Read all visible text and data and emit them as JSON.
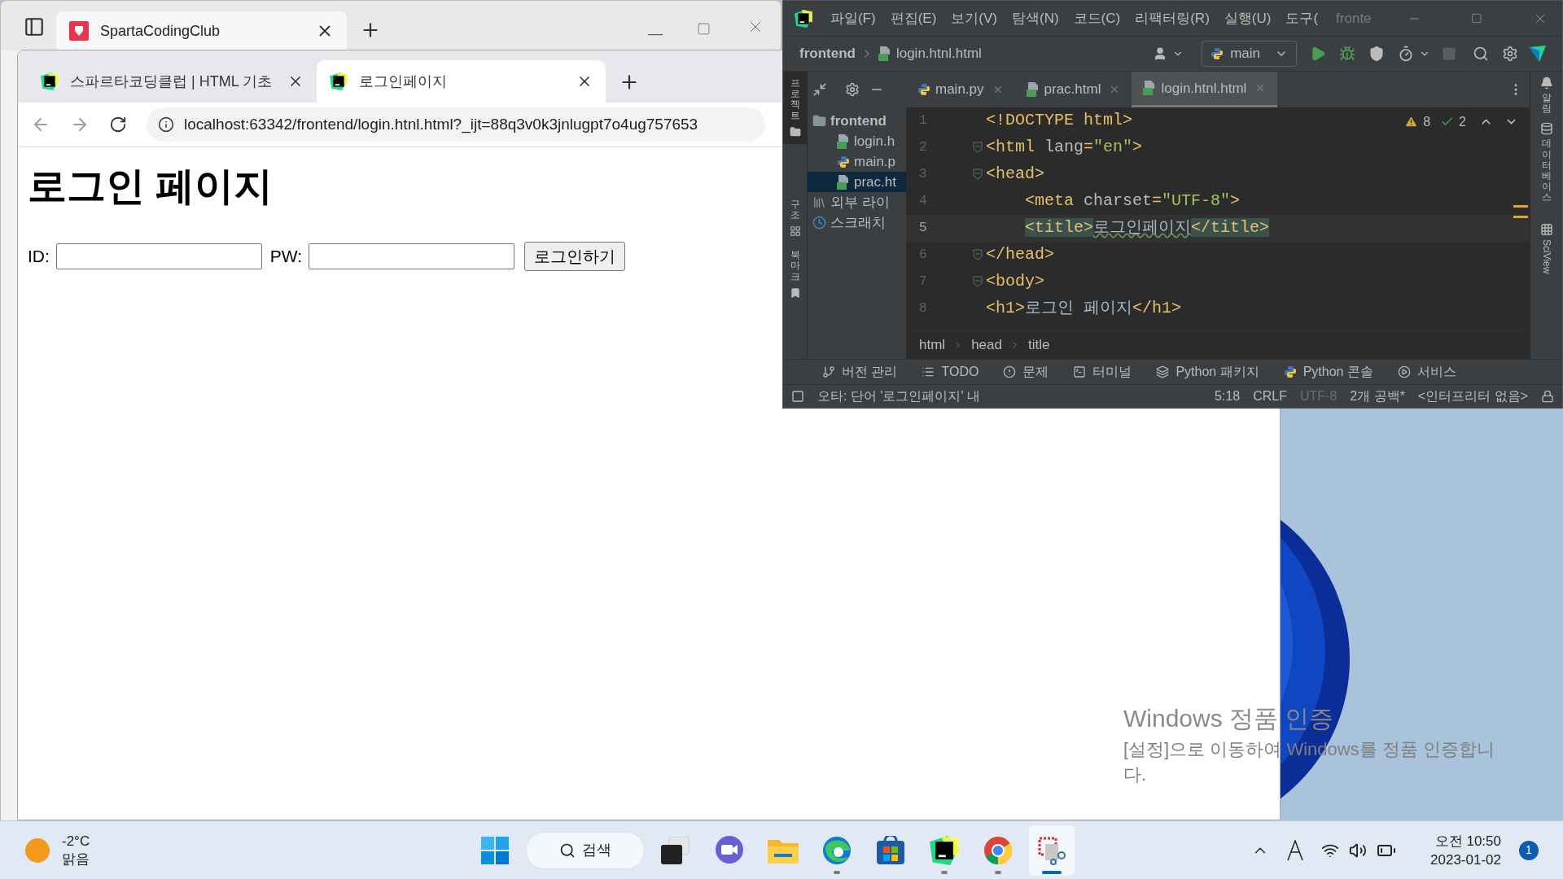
{
  "back_browser": {
    "tab_title": "SpartaCodingClub"
  },
  "browser": {
    "tabs": [
      {
        "title": "스파르타코딩클럽 | HTML 기초",
        "selected": false
      },
      {
        "title": "로그인페이지",
        "selected": true
      }
    ],
    "address": "localhost:63342/frontend/login.htnl.html?_ijt=88q3v0k3jnlugpt7o4ug757653",
    "page": {
      "heading": "로그인 페이지",
      "fields": [
        {
          "label": "ID:"
        },
        {
          "label": "PW:"
        }
      ],
      "button": "로그인하기"
    }
  },
  "ide": {
    "menu": [
      "파일(F)",
      "편집(E)",
      "보기(V)",
      "탐색(N)",
      "코드(C)",
      "리팩터링(R)",
      "실행(U)",
      "도구("
    ],
    "title": "fronte",
    "nav_project": "frontend",
    "nav_file": "login.htnl.html",
    "run_config": "main",
    "left_tools": [
      {
        "label": "프로젝트",
        "kind": "folder",
        "selected": true
      },
      {
        "label": "구조",
        "kind": "structure",
        "selected": false
      },
      {
        "label": "북마크",
        "kind": "bookmark",
        "selected": false
      }
    ],
    "right_tools": [
      {
        "label": "알림",
        "kind": "bell"
      },
      {
        "label": "데이터베이스",
        "kind": "database"
      },
      {
        "label": "SciView",
        "kind": "grid"
      }
    ],
    "tree": [
      {
        "label": "frontend",
        "kind": "folder",
        "selected": false,
        "children": [
          {
            "label": "login.h",
            "kind": "html",
            "selected": false
          },
          {
            "label": "main.p",
            "kind": "python",
            "selected": false
          },
          {
            "label": "prac.ht",
            "kind": "html",
            "selected": true
          }
        ]
      },
      {
        "label": "외부 라이",
        "kind": "library",
        "selected": false
      },
      {
        "label": "스크래치",
        "kind": "scratch",
        "selected": false
      }
    ],
    "editor_tabs": [
      {
        "label": "main.py",
        "kind": "python",
        "selected": false
      },
      {
        "label": "prac.html",
        "kind": "html",
        "selected": false
      },
      {
        "label": "login.htnl.html",
        "kind": "html",
        "selected": true
      }
    ],
    "inspections": {
      "warnings": "8",
      "ok": "2"
    },
    "code": [
      {
        "number": "1",
        "current": false,
        "fold": false,
        "segments": [
          {
            "t": "<!DOCTYPE html>",
            "kind": "tag"
          }
        ]
      },
      {
        "number": "2",
        "current": false,
        "fold": true,
        "segments": [
          {
            "t": "<html ",
            "kind": "tag"
          },
          {
            "t": "lang",
            "kind": "attr"
          },
          {
            "t": "=",
            "kind": "tag"
          },
          {
            "t": "\"en\"",
            "kind": "string"
          },
          {
            "t": ">",
            "kind": "tag"
          }
        ]
      },
      {
        "number": "3",
        "current": false,
        "fold": true,
        "segments": [
          {
            "t": "<head>",
            "kind": "tag"
          }
        ],
        "children": [
          {
            "number": "4",
            "current": false,
            "fold": false,
            "segments": [
              {
                "t": "<meta ",
                "kind": "tag"
              },
              {
                "t": "charset",
                "kind": "attr"
              },
              {
                "t": "=",
                "kind": "tag"
              },
              {
                "t": "\"UTF-8\"",
                "kind": "string"
              },
              {
                "t": ">",
                "kind": "tag"
              }
            ]
          },
          {
            "number": "5",
            "current": true,
            "fold": false,
            "segments": [
              {
                "t": "<title>",
                "kind": "tag_match"
              },
              {
                "t": "로그인페이지",
                "kind": "typo"
              },
              {
                "t": "</title>",
                "kind": "tag_match"
              }
            ]
          }
        ]
      },
      {
        "number": "6",
        "current": false,
        "fold": true,
        "segments": [
          {
            "t": "</head>",
            "kind": "tag"
          }
        ]
      },
      {
        "number": "7",
        "current": false,
        "fold": true,
        "segments": [
          {
            "t": "<body>",
            "kind": "tag"
          }
        ]
      },
      {
        "number": "8",
        "current": false,
        "fold": false,
        "segments": [
          {
            "t": "<h1>",
            "kind": "tag"
          },
          {
            "t": "로그인 페이지",
            "kind": "text"
          },
          {
            "t": "</h1>",
            "kind": "tag"
          }
        ]
      }
    ],
    "breadcrumb": [
      "html",
      "head",
      "title"
    ],
    "tool_windows": [
      {
        "label": "버전 관리",
        "kind": "vcs"
      },
      {
        "label": "TODO",
        "kind": "todo"
      },
      {
        "label": "문제",
        "kind": "problems"
      },
      {
        "label": "터미널",
        "kind": "terminal"
      },
      {
        "label": "Python 패키지",
        "kind": "packages"
      },
      {
        "label": "Python 콘솔",
        "kind": "console"
      },
      {
        "label": "서비스",
        "kind": "services"
      }
    ],
    "status": {
      "message": "오타: 단어 '로그인페이지' 내",
      "items": [
        {
          "text": "5:18",
          "disabled": false
        },
        {
          "text": "CRLF",
          "disabled": false
        },
        {
          "text": "UTF-8",
          "disabled": true
        },
        {
          "text": "2개 공백*",
          "disabled": false
        },
        {
          "text": "<인터프리터 없음>",
          "disabled": false
        }
      ]
    }
  },
  "activation": {
    "title": "Windows 정품 인증",
    "text": "[설정]으로 이동하여 Windows를 정품 인증합니다."
  },
  "taskbar": {
    "weather": {
      "temp": "-2°C",
      "condition": "맑음"
    },
    "search": "검색",
    "apps": [
      {
        "kind": "start",
        "running": false,
        "active": false
      },
      {
        "kind": "taskview",
        "running": false,
        "active": false
      },
      {
        "kind": "chat",
        "running": false,
        "active": false
      },
      {
        "kind": "explorer",
        "running": false,
        "active": false
      },
      {
        "kind": "edge",
        "running": true,
        "active": false
      },
      {
        "kind": "store",
        "running": false,
        "active": false
      },
      {
        "kind": "pycharm",
        "running": true,
        "active": false
      },
      {
        "kind": "chrome",
        "running": true,
        "active": false
      },
      {
        "kind": "snip",
        "running": true,
        "active": true
      }
    ],
    "time": "오전 10:50",
    "date": "2023-01-02",
    "notifications": "1"
  }
}
